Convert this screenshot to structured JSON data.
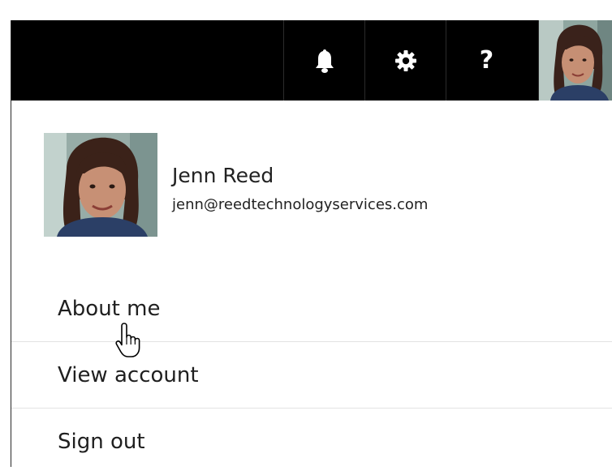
{
  "toolbar": {
    "notifications_icon": "bell-icon",
    "settings_icon": "gear-icon",
    "help_label": "?",
    "avatar": "user-avatar"
  },
  "profile": {
    "name": "Jenn Reed",
    "email": "jenn@reedtechnologyservices.com"
  },
  "menu": {
    "items": [
      {
        "label": "About me"
      },
      {
        "label": "View account"
      },
      {
        "label": "Sign out"
      }
    ]
  },
  "colors": {
    "topbar_bg": "#000000",
    "panel_bg": "#ffffff",
    "divider": "#e3e3e3",
    "text": "#1f1f1f"
  }
}
